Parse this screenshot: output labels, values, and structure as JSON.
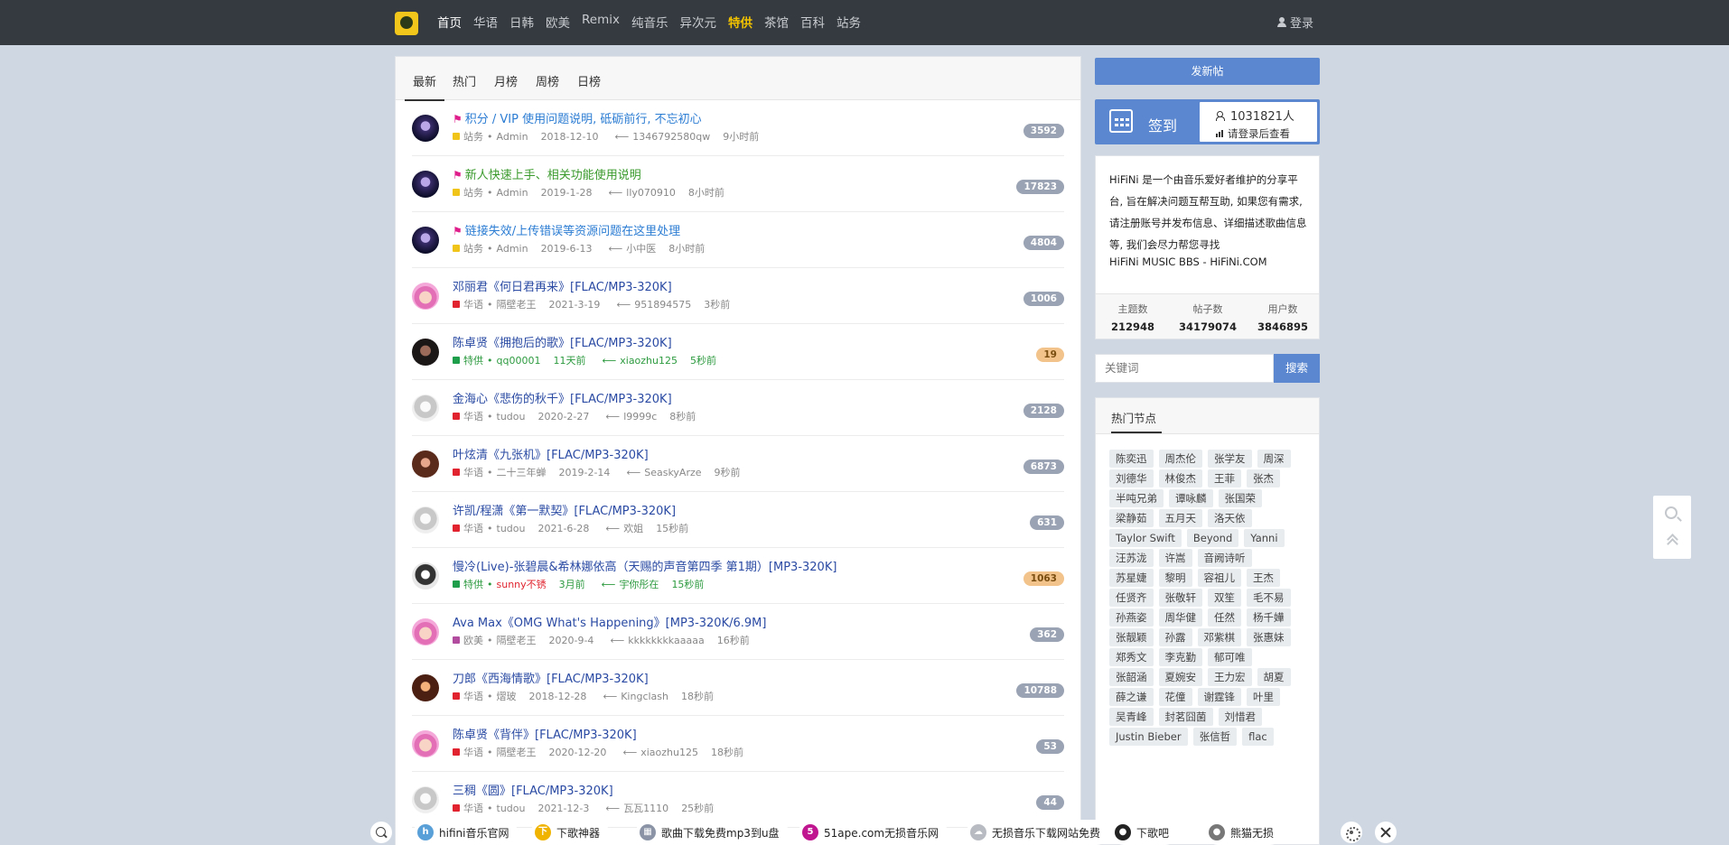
{
  "nav": {
    "links": [
      {
        "label": "首页",
        "state": "active"
      },
      {
        "label": "华语",
        "state": ""
      },
      {
        "label": "日韩",
        "state": ""
      },
      {
        "label": "欧美",
        "state": ""
      },
      {
        "label": "Remix",
        "state": ""
      },
      {
        "label": "纯音乐",
        "state": ""
      },
      {
        "label": "异次元",
        "state": ""
      },
      {
        "label": "特供",
        "state": "special"
      },
      {
        "label": "茶馆",
        "state": ""
      },
      {
        "label": "百科",
        "state": ""
      },
      {
        "label": "站务",
        "state": ""
      }
    ],
    "login": "登录"
  },
  "tabs": [
    "最新",
    "热门",
    "月榜",
    "周榜",
    "日榜"
  ],
  "colors": {
    "accent": "#5a87cf",
    "navbar": "#343a40",
    "special": "#f2c200",
    "tag_yellow": "#f0c419",
    "tag_red": "#e0232e",
    "tag_green": "#1e9e4a",
    "tag_purple": "#b24c9e"
  },
  "threads": [
    {
      "avatar": "admin",
      "flag": true,
      "title": "积分 / VIP 使用问题说明, 砥砺前行, 不忘初心",
      "title_color": "blue",
      "tag_color": "tag_yellow",
      "forum": "站务",
      "author": "Admin",
      "author_red": false,
      "date": "2018-12-10",
      "last_user": "1346792580qw",
      "last_time": "9小时前",
      "count": "3592",
      "badge": "",
      "meta_color": ""
    },
    {
      "avatar": "admin",
      "flag": true,
      "title": "新人快速上手、相关功能使用说明",
      "title_color": "green",
      "tag_color": "tag_yellow",
      "forum": "站务",
      "author": "Admin",
      "author_red": false,
      "date": "2019-1-28",
      "last_user": "lly070910",
      "last_time": "8小时前",
      "count": "17823",
      "badge": "",
      "meta_color": ""
    },
    {
      "avatar": "admin",
      "flag": true,
      "title": "链接失效/上传错误等资源问题在这里处理",
      "title_color": "blue",
      "tag_color": "tag_yellow",
      "forum": "站务",
      "author": "Admin",
      "author_red": false,
      "date": "2019-6-13",
      "last_user": "小中医",
      "last_time": "8小时前",
      "count": "4804",
      "badge": "",
      "meta_color": ""
    },
    {
      "avatar": "girl",
      "flag": false,
      "title": "邓丽君《何日君再来》[FLAC/MP3-320K]",
      "title_color": "",
      "tag_color": "tag_red",
      "forum": "华语",
      "author": "隔壁老王",
      "author_red": false,
      "date": "2021-3-19",
      "last_user": "951894575",
      "last_time": "3秒前",
      "count": "1006",
      "badge": "",
      "meta_color": ""
    },
    {
      "avatar": "qq",
      "flag": false,
      "title": "陈卓贤《拥抱后的歌》[FLAC/MP3-320K]",
      "title_color": "",
      "tag_color": "tag_green",
      "forum": "特供",
      "author": "qq00001",
      "author_red": false,
      "date": "11天前",
      "last_user": "xiaozhu125",
      "last_time": "5秒前",
      "count": "19",
      "badge": "orange",
      "meta_color": "green"
    },
    {
      "avatar": "tudou",
      "flag": false,
      "title": "金海心《悲伤的秋千》[FLAC/MP3-320K]",
      "title_color": "",
      "tag_color": "tag_red",
      "forum": "华语",
      "author": "tudou",
      "author_red": false,
      "date": "2020-2-27",
      "last_user": "l9999c",
      "last_time": "8秒前",
      "count": "2128",
      "badge": "",
      "meta_color": ""
    },
    {
      "avatar": "t23",
      "flag": false,
      "title": "叶炫清《九张机》[FLAC/MP3-320K]",
      "title_color": "",
      "tag_color": "tag_red",
      "forum": "华语",
      "author": "二十三年蝉",
      "author_red": false,
      "date": "2019-2-14",
      "last_user": "SeaskyArze",
      "last_time": "9秒前",
      "count": "6873",
      "badge": "",
      "meta_color": ""
    },
    {
      "avatar": "tudou",
      "flag": false,
      "title": "许凯/程潇《第一默契》[FLAC/MP3-320K]",
      "title_color": "",
      "tag_color": "tag_red",
      "forum": "华语",
      "author": "tudou",
      "author_red": false,
      "date": "2021-6-28",
      "last_user": "欢姐",
      "last_time": "15秒前",
      "count": "631",
      "badge": "",
      "meta_color": ""
    },
    {
      "avatar": "sunny",
      "flag": false,
      "title": "慢冷(Live)-张碧晨&希林娜依高（天赐的声音第四季 第1期）[MP3-320K]",
      "title_color": "",
      "tag_color": "tag_green",
      "forum": "特供",
      "author": "sunny不锈",
      "author_red": true,
      "date": "3月前",
      "last_user": "宇你彤在",
      "last_time": "15秒前",
      "count": "1063",
      "badge": "orange",
      "meta_color": "green"
    },
    {
      "avatar": "girl",
      "flag": false,
      "title": "Ava Max《OMG What's Happening》[MP3-320K/6.9M]",
      "title_color": "",
      "tag_color": "tag_purple",
      "forum": "欧美",
      "author": "隔壁老王",
      "author_red": false,
      "date": "2020-9-4",
      "last_user": "kkkkkkkkaaaaa",
      "last_time": "16秒前",
      "count": "362",
      "badge": "",
      "meta_color": ""
    },
    {
      "avatar": "xiong",
      "flag": false,
      "title": "刀郎《西海情歌》[FLAC/MP3-320K]",
      "title_color": "",
      "tag_color": "tag_red",
      "forum": "华语",
      "author": "熠玻",
      "author_red": false,
      "date": "2018-12-28",
      "last_user": "Kingclash",
      "last_time": "18秒前",
      "count": "10788",
      "badge": "",
      "meta_color": ""
    },
    {
      "avatar": "girl",
      "flag": false,
      "title": "陈卓贤《背伴》[FLAC/MP3-320K]",
      "title_color": "",
      "tag_color": "tag_red",
      "forum": "华语",
      "author": "隔壁老王",
      "author_red": false,
      "date": "2020-12-20",
      "last_user": "xiaozhu125",
      "last_time": "18秒前",
      "count": "53",
      "badge": "",
      "meta_color": ""
    },
    {
      "avatar": "tudou",
      "flag": false,
      "title": "三稠《圆》[FLAC/MP3-320K]",
      "title_color": "",
      "tag_color": "tag_red",
      "forum": "华语",
      "author": "tudou",
      "author_red": false,
      "date": "2021-12-3",
      "last_user": "瓦瓦1110",
      "last_time": "25秒前",
      "count": "44",
      "badge": "",
      "meta_color": ""
    }
  ],
  "sidebar": {
    "post_button": "发新帖",
    "sign_label": "签到",
    "sign_count": "1031821人",
    "sign_login": "请登录后查看",
    "intro": "HiFiNi 是一个由音乐爱好者维护的分享平台, 旨在解决问题互帮互助, 如果您有需求, 请注册账号并发布信息、详细描述歌曲信息等, 我们会尽力帮您寻找",
    "intro_sub": "HiFiNi MUSIC BBS - HiFiNi.COM",
    "stats": [
      {
        "label": "主题数",
        "value": "212948"
      },
      {
        "label": "帖子数",
        "value": "34179074"
      },
      {
        "label": "用户数",
        "value": "3846895"
      }
    ],
    "search_placeholder": "关键词",
    "search_button": "搜索",
    "nodes_title": "热门节点",
    "node_rows": [
      [
        "陈奕迅",
        "周杰伦",
        "张学友",
        "周深"
      ],
      [
        "刘德华",
        "林俊杰",
        "王菲",
        "张杰"
      ],
      [
        "半吨兄弟",
        "谭咏麟",
        "张国荣"
      ],
      [
        "梁静茹",
        "五月天",
        "洛天依"
      ],
      [
        "Taylor Swift",
        "Beyond",
        "Yanni"
      ],
      [
        "汪苏泷",
        "许嵩",
        "音阙诗听"
      ],
      [
        "苏星婕",
        "黎明",
        "容祖儿",
        "王杰"
      ],
      [
        "任贤齐",
        "张敬轩",
        "双笙",
        "毛不易"
      ],
      [
        "孙燕姿",
        "周华健",
        "任然",
        "杨千嬅"
      ],
      [
        "张靓颖",
        "孙露",
        "邓紫棋",
        "张惠妹"
      ],
      [
        "郑秀文",
        "李克勤",
        "郁可唯"
      ],
      [
        "张韶涵",
        "夏婉安",
        "王力宏",
        "胡夏"
      ],
      [
        "薛之谦",
        "花僮",
        "谢霆锋",
        "叶里"
      ],
      [
        "吴青峰",
        "封茗囧菌",
        "刘惜君"
      ],
      [
        "Justin Bieber",
        "张信哲",
        "flac"
      ]
    ]
  },
  "bookmarks": [
    {
      "icon": "h",
      "color": "#5aa0d8",
      "label": "hifini音乐官网"
    },
    {
      "icon": "下",
      "color": "#f0b400",
      "label": "下歌神器"
    },
    {
      "icon": "▦",
      "color": "#8a94a6",
      "label": "歌曲下载免费mp3到u盘"
    },
    {
      "icon": "5",
      "color": "#c01690",
      "label": "51ape.com无损音乐网"
    },
    {
      "icon": "☁",
      "color": "#b8bcc2",
      "label": "无损音乐下载网站免费"
    },
    {
      "icon": "●",
      "color": "#222222",
      "label": "下歌吧"
    },
    {
      "icon": "●",
      "color": "#777777",
      "label": "熊猫无损"
    }
  ]
}
